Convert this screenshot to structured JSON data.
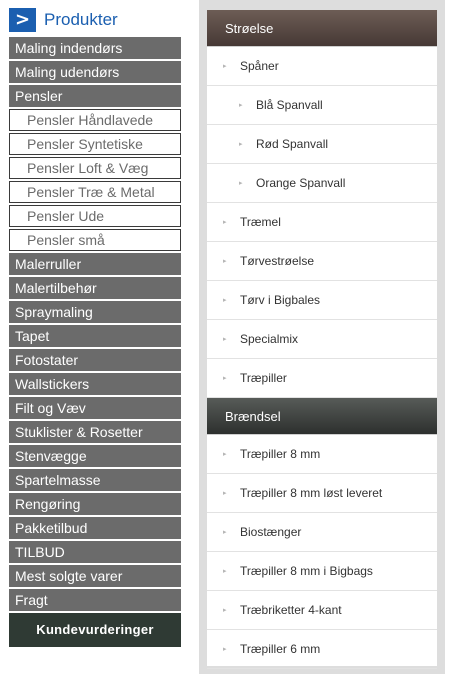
{
  "products": {
    "arrow_glyph": ">",
    "title": "Produkter",
    "items": [
      {
        "label": "Maling indendørs",
        "sub": false
      },
      {
        "label": "Maling udendørs",
        "sub": false
      },
      {
        "label": "Pensler",
        "sub": false
      },
      {
        "label": "Pensler Håndlavede",
        "sub": true
      },
      {
        "label": "Pensler Syntetiske",
        "sub": true
      },
      {
        "label": "Pensler Loft & Væg",
        "sub": true
      },
      {
        "label": "Pensler Træ & Metal",
        "sub": true
      },
      {
        "label": "Pensler Ude",
        "sub": true
      },
      {
        "label": "Pensler små",
        "sub": true
      },
      {
        "label": "Malerruller",
        "sub": false
      },
      {
        "label": "Malertilbehør",
        "sub": false
      },
      {
        "label": "Spraymaling",
        "sub": false
      },
      {
        "label": "Tapet",
        "sub": false
      },
      {
        "label": "Fotostater",
        "sub": false
      },
      {
        "label": "Wallstickers",
        "sub": false
      },
      {
        "label": "Filt og Væv",
        "sub": false
      },
      {
        "label": "Stuklister & Rosetter",
        "sub": false
      },
      {
        "label": "Stenvægge",
        "sub": false
      },
      {
        "label": "Spartelmasse",
        "sub": false
      },
      {
        "label": "Rengøring",
        "sub": false
      },
      {
        "label": "Pakketilbud",
        "sub": false
      },
      {
        "label": "TILBUD",
        "sub": false
      },
      {
        "label": "Mest solgte varer",
        "sub": false
      },
      {
        "label": "Fragt",
        "sub": false
      }
    ],
    "reviews_button": "Kundevurderinger"
  },
  "right_panel": {
    "bullet_glyph": "▸",
    "sections": [
      {
        "title": "Strøelse",
        "items": [
          {
            "label": "Spåner",
            "sub": false
          },
          {
            "label": "Blå Spanvall",
            "sub": true
          },
          {
            "label": "Rød Spanvall",
            "sub": true
          },
          {
            "label": "Orange Spanvall",
            "sub": true
          },
          {
            "label": "Træmel",
            "sub": false
          },
          {
            "label": "Tørvestrøelse",
            "sub": false
          },
          {
            "label": "Tørv i Bigbales",
            "sub": false
          },
          {
            "label": "Specialmix",
            "sub": false
          },
          {
            "label": "Træpiller",
            "sub": false
          }
        ]
      },
      {
        "title": "Brændsel",
        "items": [
          {
            "label": "Træpiller 8 mm",
            "sub": false
          },
          {
            "label": "Træpiller 8 mm løst leveret",
            "sub": false
          },
          {
            "label": "Biostænger",
            "sub": false
          },
          {
            "label": "Træpiller 8 mm i Bigbags",
            "sub": false
          },
          {
            "label": "Træbriketter 4-kant",
            "sub": false
          },
          {
            "label": "Træpiller 6 mm",
            "sub": false
          }
        ]
      }
    ]
  },
  "colors": {
    "brand_blue": "#1b5fb0",
    "menu_gray": "#6b6b6b",
    "reviews_dark": "#2f3a34",
    "section_brown": "#463935",
    "section_dark": "#2d302e"
  }
}
